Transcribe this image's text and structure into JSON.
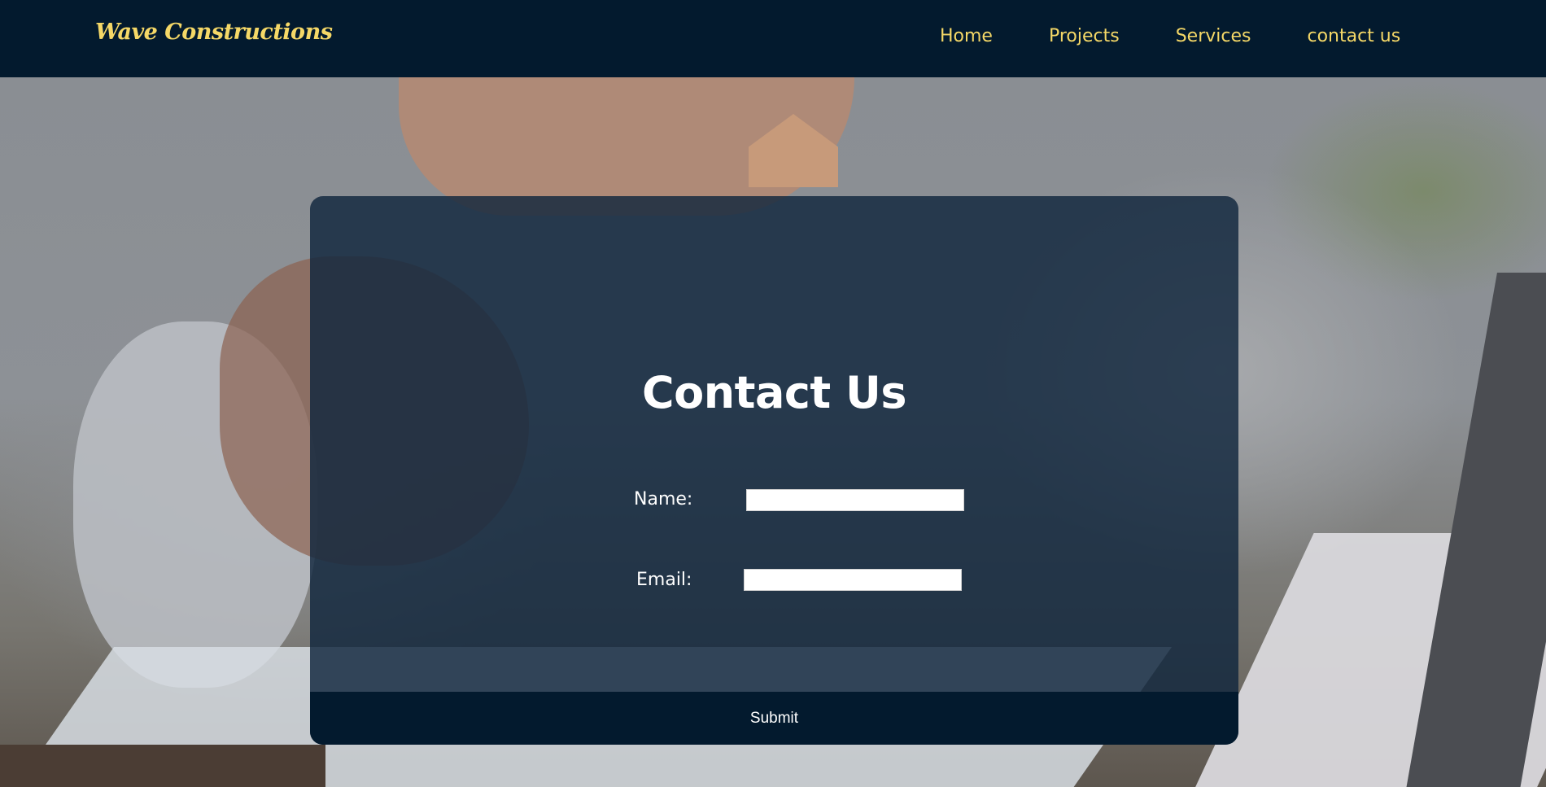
{
  "header": {
    "logo": "Wave Constructions",
    "nav": [
      {
        "label": "Home"
      },
      {
        "label": "Projects"
      },
      {
        "label": "Services"
      },
      {
        "label": "contact us"
      }
    ]
  },
  "contact": {
    "title": "Contact Us",
    "name_label": "Name:",
    "name_value": "",
    "email_label": "Email:",
    "email_value": "",
    "submit_label": "Submit"
  },
  "colors": {
    "navbar_bg": "#031a2e",
    "accent_yellow": "#f5d867",
    "card_overlay": "#10263d",
    "text_white": "#ffffff"
  }
}
